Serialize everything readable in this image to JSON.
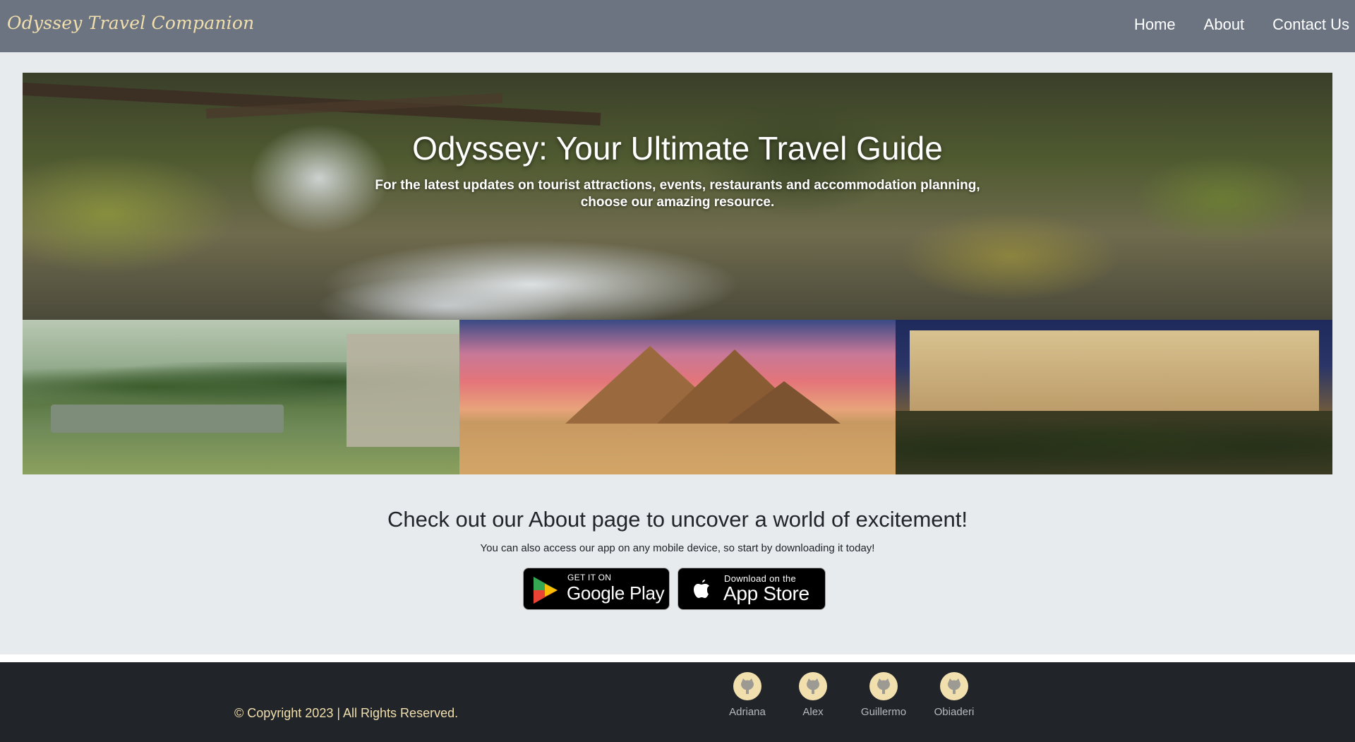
{
  "nav": {
    "brand": "Odyssey Travel Companion",
    "links": [
      {
        "label": "Home"
      },
      {
        "label": "About"
      },
      {
        "label": "Contact Us"
      }
    ]
  },
  "hero": {
    "title": "Odyssey: Your Ultimate Travel Guide",
    "subtitle_line1": "For the latest updates on tourist attractions, events, restaurants and accommodation planning,",
    "subtitle_line2": "choose our amazing resource."
  },
  "gallery": {
    "tiles": [
      {
        "icon": "garden-image"
      },
      {
        "icon": "pyramids-image"
      },
      {
        "icon": "palace-image"
      }
    ]
  },
  "cta": {
    "title": "Check out our About page to uncover a world of excitement!",
    "subtitle": "You can also access our app on any mobile device, so start by downloading it today!",
    "google_play": {
      "small": "GET IT ON",
      "big": "Google Play"
    },
    "app_store": {
      "small": "Download on the",
      "big": "App Store"
    }
  },
  "footer": {
    "copyright": "© Copyright 2023 | All Rights Reserved.",
    "developers": [
      {
        "name": "Adriana",
        "icon": "github-icon"
      },
      {
        "name": "Alex",
        "icon": "github-icon"
      },
      {
        "name": "Guillermo",
        "icon": "github-icon"
      },
      {
        "name": "Obiaderi",
        "icon": "github-icon"
      }
    ]
  },
  "colors": {
    "navbar": "#6b7480",
    "brand": "#f2dfae",
    "page_bg": "#e8ebee",
    "footer_bg": "#212529"
  }
}
